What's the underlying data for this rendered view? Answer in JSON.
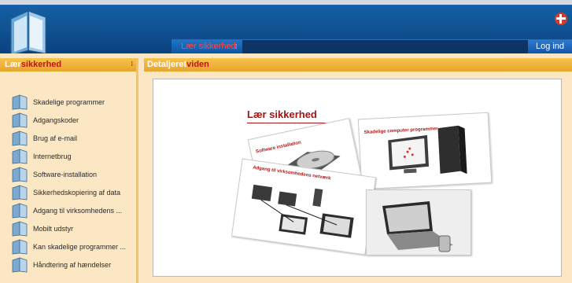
{
  "header": {
    "nav_item": "Lær sikkerhed",
    "login_label": "Log ind"
  },
  "left_panel": {
    "title_prefix": "Lær",
    "title_accent": "sikkerhed",
    "items": [
      {
        "label": "Skadelige programmer"
      },
      {
        "label": "Adgangskoder"
      },
      {
        "label": "Brug af e-mail"
      },
      {
        "label": "Internetbrug"
      },
      {
        "label": "Software-installation"
      },
      {
        "label": "Sikkerhedskopiering af data"
      },
      {
        "label": "Adgang til virksomhedens ..."
      },
      {
        "label": "Mobilt udstyr"
      },
      {
        "label": "Kan skadelige programmer ..."
      },
      {
        "label": "Håndtering af hændelser"
      }
    ]
  },
  "right_panel": {
    "title_prefix": "Detaljeret",
    "title_accent": "viden"
  },
  "collage": {
    "main_title": "Lær sikkerhed",
    "sheet1_title": "Software installation",
    "sheet2_title": "Skadelige computer programmer",
    "sheet3_title": "Adgang til virksomhedens netværk"
  },
  "colors": {
    "header_blue": "#0f4f8e",
    "panel_orange": "#f0b43e",
    "accent_red": "#c0131a",
    "background": "#fbe7c3"
  }
}
